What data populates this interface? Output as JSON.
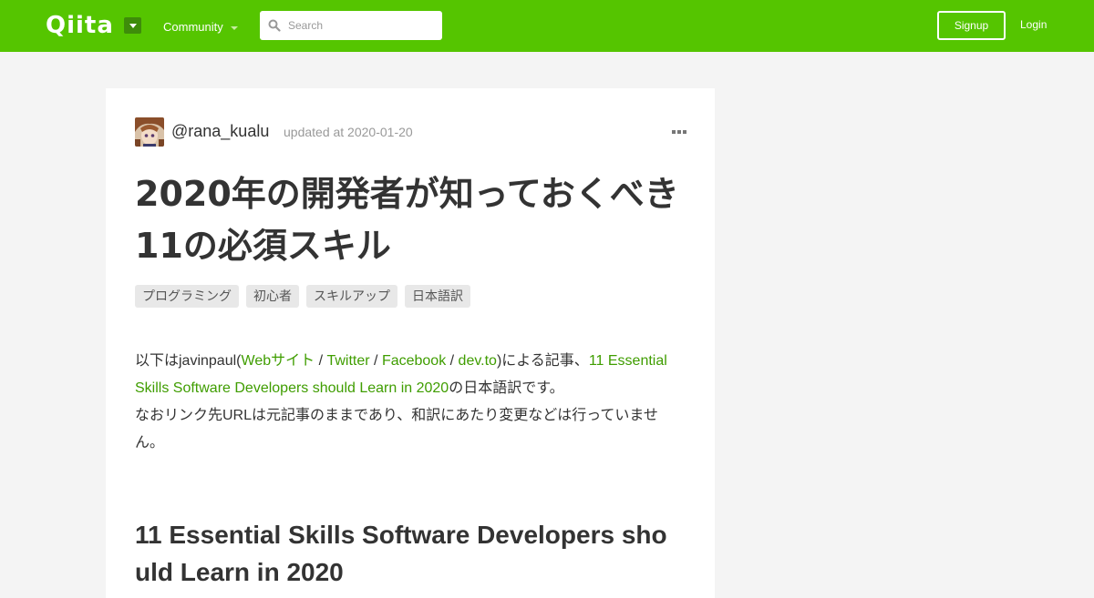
{
  "header": {
    "logo": "Qiita",
    "community_label": "Community",
    "search_placeholder": "Search",
    "signup_label": "Signup",
    "login_label": "Login"
  },
  "article": {
    "author": "@rana_kualu",
    "updated": "updated at 2020-01-20",
    "title": "2020年の開発者が知っておくべき11の必須スキル",
    "tags": [
      "プログラミング",
      "初心者",
      "スキルアップ",
      "日本語訳"
    ],
    "body": {
      "intro_prefix": "以下はjavinpaul(",
      "link_website": "Webサイト",
      "sep1": " / ",
      "link_twitter": "Twitter",
      "sep2": " / ",
      "link_facebook": "Facebook",
      "sep3": " / ",
      "link_devto": "dev.to",
      "intro_mid": ")による記事、",
      "link_original": "11 Essential Skills Software Developers should Learn in 2020",
      "intro_suffix": "の日本語訳です。",
      "note": "なおリンク先URLは元記事のままであり、和訳にあたり変更などは行っていません。"
    },
    "heading": "11 Essential Skills Software Developers should Learn in 2020"
  },
  "colors": {
    "brand": "#55c500",
    "link": "#3f9d00"
  }
}
